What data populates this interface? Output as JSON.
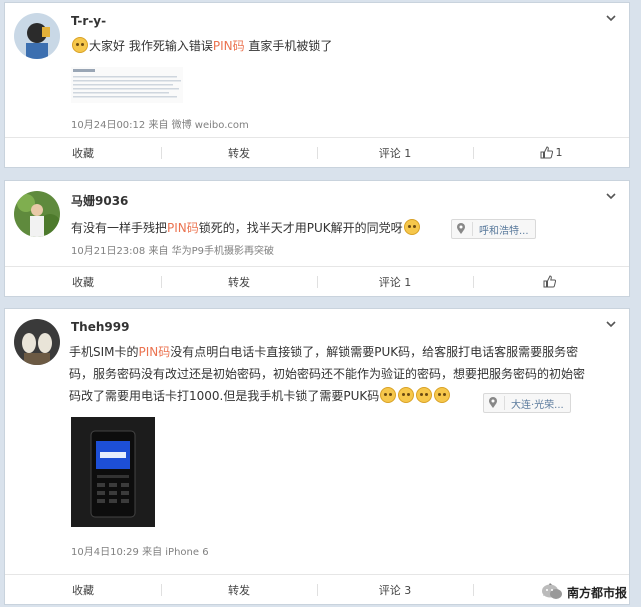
{
  "posts": [
    {
      "username": "T-r-y-",
      "text_parts": [
        "大家好 我作死输入错误",
        "PIN码",
        " 直家手机被锁了"
      ],
      "meta": "10月24日00:12 来自 微博 weibo.com",
      "actions": [
        "收藏",
        "转发",
        "评论 1",
        "1"
      ]
    },
    {
      "username": "马姗9036",
      "text_parts": [
        "有没有一样手残把",
        "PIN码",
        "锁死的，找半天才用PUK解开的同党呀"
      ],
      "location": "呼和浩特...",
      "meta": "10月21日23:08 来自 华为P9手机摄影再突破",
      "actions": [
        "收藏",
        "转发",
        "评论 1",
        ""
      ]
    },
    {
      "username": "Theh999",
      "line1_parts": [
        "手机SIM卡的",
        "PIN码",
        "没有点明白电话卡直接锁了，解锁需要PUK码，给客服打电话客服需要服务密"
      ],
      "line2": "码，服务密码没有改过还是初始密码，初始密码还不能作为验证的密码，想要把服务密码的初始密",
      "line3": "码改了需要用电话卡打1000.但是我手机卡锁了需要PUK码",
      "location": "大连·光荣...",
      "meta": "10月4日10:29 来自 iPhone 6",
      "actions": [
        "收藏",
        "转发",
        "评论 3",
        ""
      ]
    }
  ],
  "watermark": "南方都市报",
  "icons": {
    "expand": "chevron-down-icon",
    "like": "thumb-up-icon",
    "location": "location-pin-icon",
    "emoji": "emoji-icon"
  },
  "colors": {
    "highlight": "#eb7350",
    "link": "#5a7a9c"
  }
}
